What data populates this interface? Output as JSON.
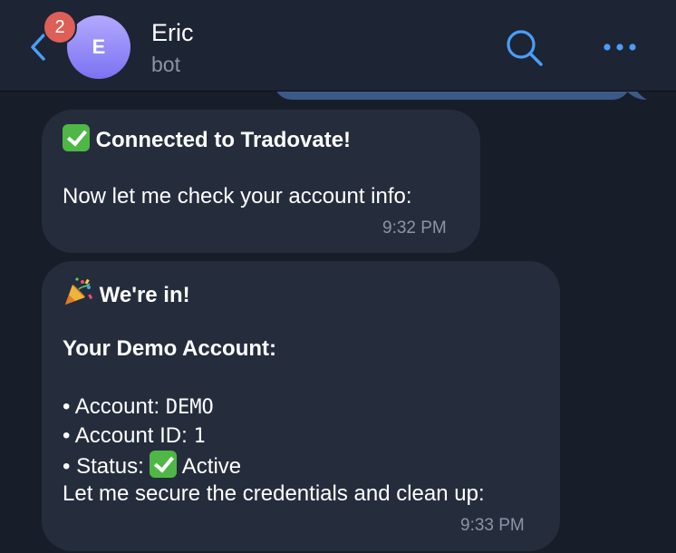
{
  "header": {
    "unread_count": "2",
    "avatar_initial": "E",
    "contact_name": "Eric",
    "contact_status": "bot"
  },
  "messages": [
    {
      "title": "Connected to Tradovate!",
      "text": "Now let me check your account info:",
      "time": "9:32 PM"
    },
    {
      "title": "We're in!",
      "subtitle": "Your Demo Account:",
      "account_label": "• Account: ",
      "account_value": "DEMO",
      "account_id_label": "• Account ID: ",
      "account_id_value": "1",
      "status_label": "• Status: ",
      "status_value": "Active",
      "footer": "Let me secure the credentials and clean up:",
      "time": "9:33 PM"
    }
  ],
  "colors": {
    "background": "#171e2a",
    "header": "#1d2433",
    "bubble_incoming": "#252d3d",
    "bubble_outgoing": "#3c5a88",
    "accent": "#4a9ef7",
    "badge": "#dd5f58",
    "check_emoji": "#4fb746"
  },
  "icons": {
    "back": "chevron-left-icon",
    "search": "search-icon",
    "more": "ellipsis-icon",
    "check": "check-mark-button-emoji",
    "party": "party-popper-emoji"
  }
}
